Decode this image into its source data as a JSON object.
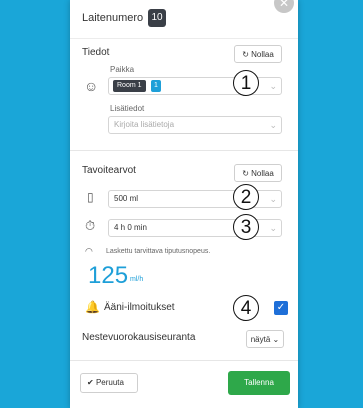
{
  "header": {
    "title": "Laitenumero",
    "device_number": "10",
    "close_icon": "close-icon"
  },
  "tiedot": {
    "title": "Tiedot",
    "reset_label": "Nollaa",
    "location_label": "Paikka",
    "room_chip": "Room 1",
    "room_number": "1",
    "extra_label": "Lisätiedot",
    "extra_placeholder": "Kirjoita lisätietoja"
  },
  "targets": {
    "title": "Tavoitearvot",
    "reset_label": "Nollaa",
    "volume_value": "500 ml",
    "time_value": "4 h 0 min",
    "rate_caption": "Laskettu tarvittava tiputusnopeus.",
    "rate_value": "125",
    "rate_unit": "ml/h"
  },
  "alerts": {
    "label": "Ääni-ilmoitukset",
    "checked": true
  },
  "shift_monitor": {
    "label": "Nestevuorokausiseuranta",
    "show_label": "näytä"
  },
  "footer": {
    "cancel_label": "Peruuta",
    "save_label": "Tallenna"
  },
  "annotations": [
    "1",
    "2",
    "3",
    "4"
  ],
  "colors": {
    "accent": "#1e9fd8",
    "save": "#2ea84a",
    "background": "#1aa6d8",
    "badge": "#3a3f47"
  }
}
